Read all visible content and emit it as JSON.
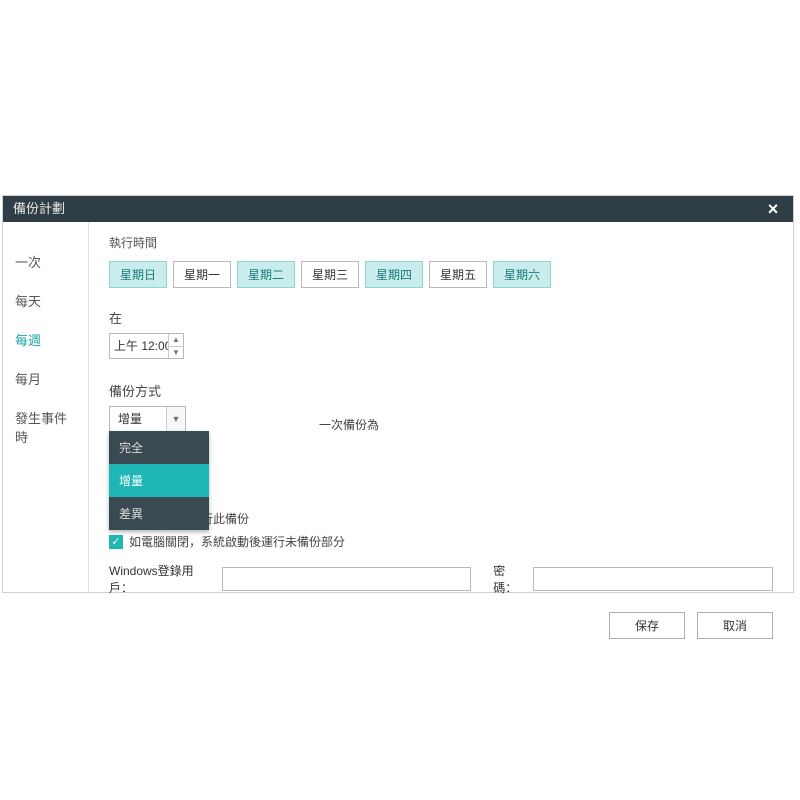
{
  "dialog": {
    "title": "備份計劃"
  },
  "sidebar": {
    "items": [
      {
        "label": "一次",
        "active": false
      },
      {
        "label": "每天",
        "active": false
      },
      {
        "label": "每週",
        "active": true
      },
      {
        "label": "每月",
        "active": false
      },
      {
        "label": "發生事件時",
        "active": false
      }
    ]
  },
  "schedule": {
    "section_label": "執行時間",
    "days": [
      {
        "label": "星期日",
        "selected": true
      },
      {
        "label": "星期一",
        "selected": false
      },
      {
        "label": "星期二",
        "selected": true
      },
      {
        "label": "星期三",
        "selected": false
      },
      {
        "label": "星期四",
        "selected": true
      },
      {
        "label": "星期五",
        "selected": false
      },
      {
        "label": "星期六",
        "selected": true
      }
    ],
    "at_label": "在",
    "time_value": "上午 12:00"
  },
  "method": {
    "label": "備份方式",
    "selected": "增量",
    "options": [
      "完全",
      "增量",
      "差異"
    ],
    "highlighted": "增量",
    "suffix_text": "一次備份為"
  },
  "options": {
    "wake": {
      "checked": true,
      "label": "喚醒電腦以運行此備份"
    },
    "missed": {
      "checked": true,
      "label": "如電腦關閉，系統啟動後運行未備份部分"
    }
  },
  "credentials": {
    "user_label": "Windows登錄用戶：",
    "pass_label": "密碼："
  },
  "buttons": {
    "save": "保存",
    "cancel": "取消"
  }
}
